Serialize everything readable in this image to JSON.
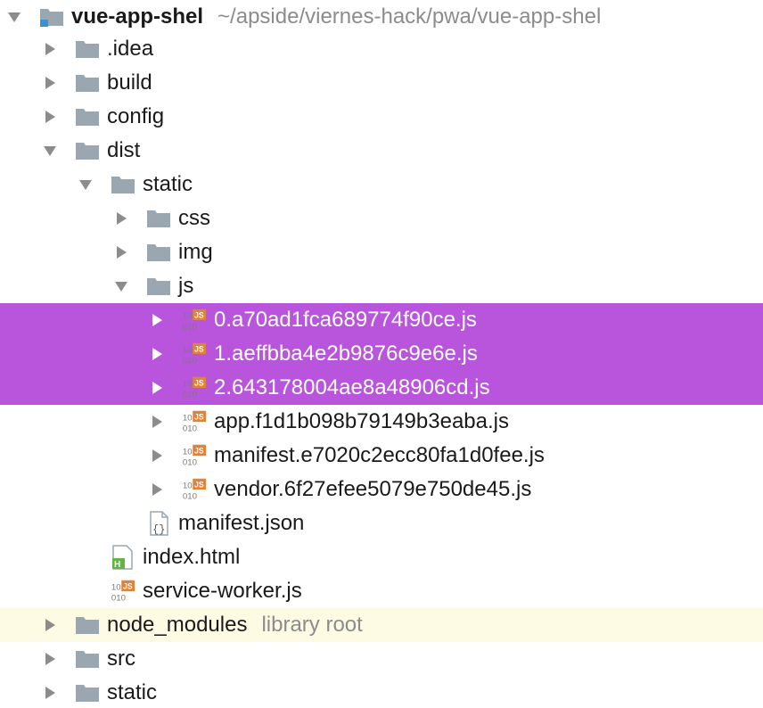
{
  "tree": {
    "root": {
      "label": "vue-app-shel",
      "path": "~/apside/viernes-hack/pwa/vue-app-shel",
      "icon": "module-folder-icon",
      "expanded": true
    },
    "items": [
      {
        "label": ".idea",
        "icon": "folder-icon",
        "expanded": false
      },
      {
        "label": "build",
        "icon": "folder-icon",
        "expanded": false
      },
      {
        "label": "config",
        "icon": "folder-icon",
        "expanded": false
      },
      {
        "label": "dist",
        "icon": "folder-icon",
        "expanded": true
      },
      {
        "label": "static",
        "icon": "folder-icon",
        "expanded": true
      },
      {
        "label": "css",
        "icon": "folder-icon",
        "expanded": false
      },
      {
        "label": "img",
        "icon": "folder-icon",
        "expanded": false
      },
      {
        "label": "js",
        "icon": "folder-icon",
        "expanded": true
      },
      {
        "label": "0.a70ad1fca689774f90ce.js",
        "icon": "js-file-icon",
        "selected": true,
        "expandable": true
      },
      {
        "label": "1.aeffbba4e2b9876c9e6e.js",
        "icon": "js-file-icon",
        "selected": true,
        "expandable": true
      },
      {
        "label": "2.643178004ae8a48906cd.js",
        "icon": "js-file-icon",
        "selected": true,
        "expandable": true
      },
      {
        "label": "app.f1d1b098b79149b3eaba.js",
        "icon": "js-file-icon",
        "selected": false,
        "expandable": true
      },
      {
        "label": "manifest.e7020c2ecc80fa1d0fee.js",
        "icon": "js-file-icon",
        "selected": false,
        "expandable": true
      },
      {
        "label": "vendor.6f27efee5079e750de45.js",
        "icon": "js-file-icon",
        "selected": false,
        "expandable": true
      },
      {
        "label": "manifest.json",
        "icon": "json-file-icon",
        "expandable": false
      },
      {
        "label": "index.html",
        "icon": "html-file-icon",
        "expandable": false
      },
      {
        "label": "service-worker.js",
        "icon": "js-file-icon",
        "expandable": false
      },
      {
        "label": "node_modules",
        "icon": "folder-icon",
        "expanded": false,
        "hint": "library root",
        "highlighted": true
      },
      {
        "label": "src",
        "icon": "folder-icon",
        "expanded": false
      },
      {
        "label": "static",
        "icon": "folder-icon",
        "expanded": false
      }
    ]
  },
  "colors": {
    "selection": "#b955dc",
    "library_root_bg": "#fdfbe3",
    "folder": "#9aa7b0",
    "arrow": "#8c8c8c",
    "js_badge": "#e0823a",
    "html_badge": "#62b543"
  }
}
